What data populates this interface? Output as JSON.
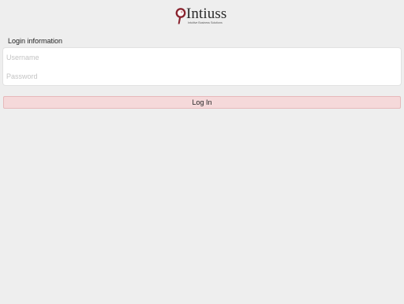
{
  "brand": {
    "name": "Intiuss",
    "tagline": "Intuitive Business Solutions",
    "logo_icon": "pin-logo-icon",
    "mark_color": "#8a2530"
  },
  "form": {
    "section_title": "Login information",
    "username": {
      "placeholder": "Username",
      "value": ""
    },
    "password": {
      "placeholder": "Password",
      "value": ""
    },
    "login_label": "Log In"
  },
  "colors": {
    "background": "#eeeeee",
    "button_background": "#f5d9da",
    "button_border": "#e6b9bb"
  }
}
